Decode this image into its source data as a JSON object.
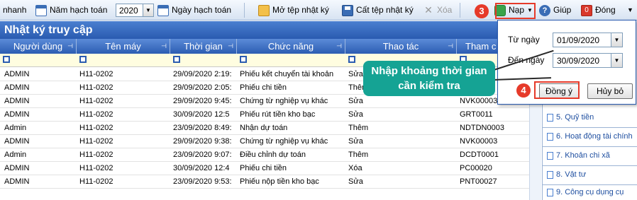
{
  "toolbar": {
    "left_label": "nhanh",
    "year_label": "Năm hạch toán",
    "year_value": "2020",
    "date_label": "Ngày hạch toán",
    "open_label": "Mở tệp nhật ký",
    "cut_label": "Cất tệp nhật ký",
    "delete_label": "Xóa",
    "load_label": "Nạp",
    "help_label": "Giúp",
    "close_label": "Đóng"
  },
  "panel_title": "Nhật ký truy cập",
  "columns": [
    "Người dùng",
    "Tên máy",
    "Thời gian",
    "Chức năng",
    "Thao tác",
    "Tham c"
  ],
  "rows": [
    [
      "ADMIN",
      "H11-0202",
      "29/09/2020 2:19:",
      "Phiếu kết chuyển tài khoản",
      "Sửa",
      ""
    ],
    [
      "ADMIN",
      "H11-0202",
      "29/09/2020 2:05:",
      "Phiếu chi tiền",
      "Thêm",
      ""
    ],
    [
      "ADMIN",
      "H11-0202",
      "29/09/2020 9:45:",
      "Chứng từ nghiệp vụ khác",
      "Sửa",
      "NVK00003"
    ],
    [
      "ADMIN",
      "H11-0202",
      "30/09/2020 12:5",
      "Phiếu rút tiền kho bạc",
      "Sửa",
      "GRT0011"
    ],
    [
      "Admin",
      "H11-0202",
      "23/09/2020 8:49:",
      "Nhận dự toán",
      "Thêm",
      "NDTDN0003"
    ],
    [
      "ADMIN",
      "H11-0202",
      "29/09/2020 9:38:",
      "Chứng từ nghiệp vụ khác",
      "Sửa",
      "NVK00003"
    ],
    [
      "Admin",
      "H11-0202",
      "23/09/2020 9:07:",
      "Điều chỉnh dự toán",
      "Thêm",
      "DCDT0001"
    ],
    [
      "ADMIN",
      "H11-0202",
      "30/09/2020 12:4",
      "Phiếu chi tiền",
      "Xóa",
      "PC00020"
    ],
    [
      "ADMIN",
      "H11-0202",
      "23/09/2020 9:53:",
      "Phiếu nộp tiền kho bạc",
      "Sửa",
      "PNT00027"
    ]
  ],
  "right_panel": [
    "5. Quỹ tiền",
    "6. Hoạt động tài chính",
    "7. Khoản chi xã",
    "8. Vật tư",
    "9. Công cụ dụng cụ"
  ],
  "dialog": {
    "from_label": "Từ ngày",
    "from_value": "01/09/2020",
    "to_label": "Đến ngày",
    "to_value": "30/09/2020",
    "ok_label": "Đồng ý",
    "cancel_label": "Hủy bỏ"
  },
  "callout_text": "Nhập khoảng thời gian cần kiểm tra",
  "badges": [
    "3",
    "4"
  ],
  "colors": {
    "accent_blue": "#2a5bb0",
    "callout_teal": "#15a394",
    "annotation_red": "#e63a2a",
    "filter_yellow": "#fffde0"
  }
}
